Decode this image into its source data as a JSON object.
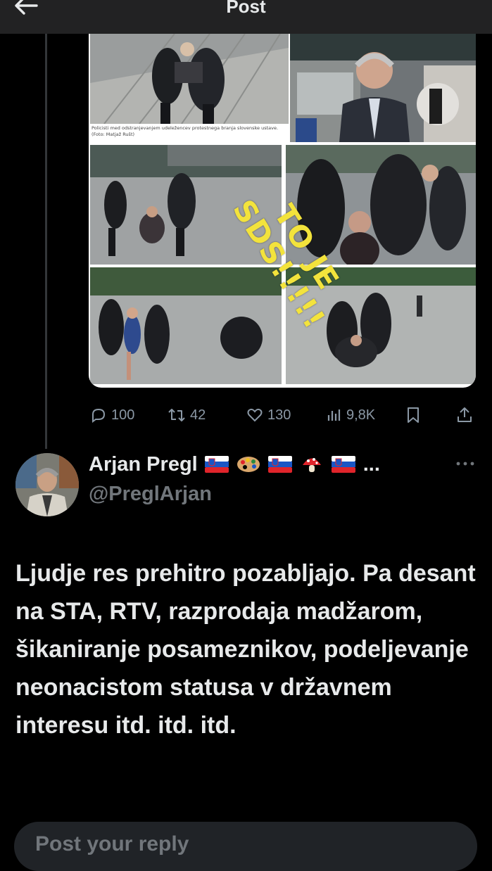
{
  "header": {
    "title": "Post",
    "back_icon": "arrow-left-icon"
  },
  "media": {
    "caption": "Policisti med odstranjevanjem udeležencev protestnega branja slovenske ustave. (Foto: Matjaž Rušt)",
    "stamp_lines": [
      "TO JE",
      "SDS!!!!!"
    ],
    "stamp_color": "#f3e33c"
  },
  "actions": {
    "replies": "100",
    "reposts": "42",
    "likes": "130",
    "views": "9,8K"
  },
  "author": {
    "name": "Arjan Pregl",
    "handle": "@PreglArjan",
    "emojis": [
      "slovenia-flag",
      "artist-palette",
      "slovenia-flag",
      "mushroom",
      "slovenia-flag"
    ],
    "name_overflow": "..."
  },
  "tweet": {
    "text": "Ljudje res prehitro pozabljajo. Pa desant na STA, RTV, razprodaja madžarom, šikaniranje posameznikov, podeljevanje neonacistom statusa v državnem interesu itd. itd. itd."
  },
  "reply": {
    "placeholder": "Post your reply"
  },
  "colors": {
    "background": "#000000",
    "text": "#e7e9ea",
    "muted": "#71767b",
    "accent": "#1d9bf0"
  }
}
